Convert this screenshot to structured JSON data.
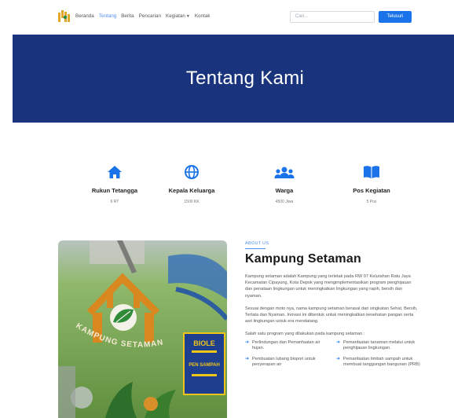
{
  "nav": {
    "items": [
      {
        "label": "Beranda"
      },
      {
        "label": "Tentang",
        "active": true
      },
      {
        "label": "Berita"
      },
      {
        "label": "Pencarian"
      },
      {
        "label": "Kegiatan",
        "dropdown": true
      },
      {
        "label": "Kontak"
      }
    ],
    "search_placeholder": "Cari...",
    "search_button": "Telusuri"
  },
  "hero": {
    "title": "Tentang Kami"
  },
  "stats": [
    {
      "icon": "home-icon",
      "label": "Rukun Tetangga",
      "value": "6 RT"
    },
    {
      "icon": "globe-icon",
      "label": "Kepala Keluarga",
      "value": "1500 KK"
    },
    {
      "icon": "users-icon",
      "label": "Warga",
      "value": "4500 Jiwa"
    },
    {
      "icon": "book-icon",
      "label": "Pos Kegiatan",
      "value": "5 Pos"
    }
  ],
  "about": {
    "eyebrow": "ABOUT US",
    "title": "Kampung Setaman",
    "paragraph1": "Kampung setaman adalah Kampung yang terletak pada RW 07 Kelurahan Ratu Jaya Kecamatan Cipayung, Kota Depok yang mengimplementasikan program penghijauan dan penataan lingkungan untuk meningkatkan lingkungan yang rapih, bersih dan nyaman.",
    "paragraph2": "Sesuai dengan moto nya, nama kampung setaman berasal dari singkatan Sehat, Bersih, Tertata dan Nyaman. Inovasi ini dibentuk untuk meningkatkan kesehatan pangan serta asri lingkungan untuk era mendatang.",
    "paragraph3": "Salah satu program yang dilakukan pada kampung setaman :",
    "list": [
      "Perlindungan dan Pemanfaatan air hujan.",
      "Pemanfaatan tanaman melalui untuk penghijauan lingkungan.",
      "Pembuatan lubang biopori untuk penyerapan air",
      "Pemanfaatan timbah sampah untuk membuat tanggungan bangunan (PRB)"
    ]
  },
  "photo": {
    "mural_text": "KAMPUNG SETAMAN",
    "sign_title": "BIOLE",
    "sign_sub": "PEN SAMPAH"
  },
  "colors": {
    "hero": "#19337c",
    "accent": "#1a73e8",
    "text": "#333333"
  }
}
